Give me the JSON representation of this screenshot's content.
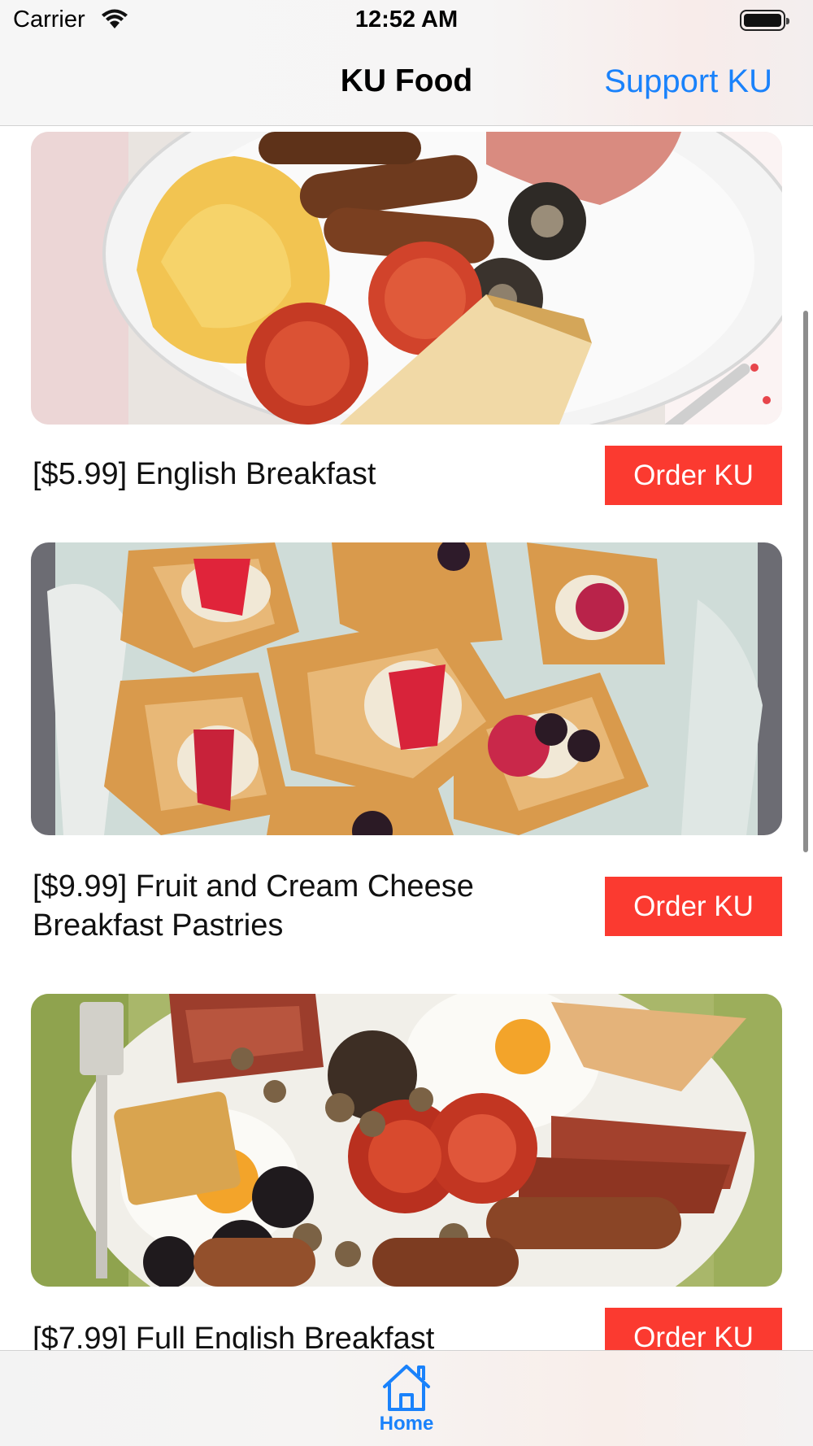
{
  "status_bar": {
    "carrier": "Carrier",
    "time": "12:52 AM",
    "icons": [
      "wifi-icon",
      "battery-icon"
    ]
  },
  "nav": {
    "title": "KU Food",
    "right_action": "Support KU"
  },
  "items": [
    {
      "title": "[$5.99] English Breakfast",
      "button": "Order KU",
      "image_icon": "english-breakfast-photo"
    },
    {
      "title": "[$9.99] Fruit and Cream Cheese Breakfast Pastries",
      "button": "Order KU",
      "image_icon": "pastries-photo"
    },
    {
      "title": "[$7.99] Full English Breakfast",
      "button": "Order KU",
      "image_icon": "full-english-breakfast-photo"
    }
  ],
  "tab_bar": {
    "tabs": [
      {
        "label": "Home",
        "icon": "house-icon",
        "selected": true
      }
    ]
  },
  "colors": {
    "accent_blue": "#1a82fb",
    "order_red": "#fb3a30"
  }
}
